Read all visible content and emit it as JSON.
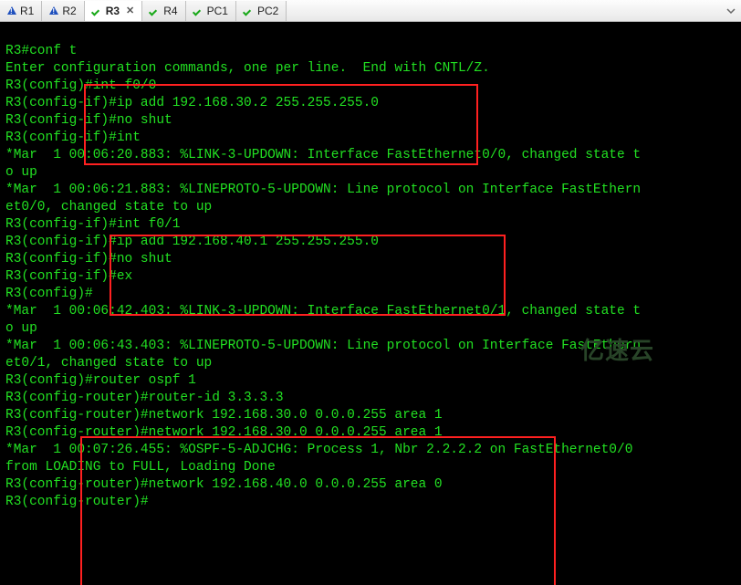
{
  "tabs": [
    {
      "label": "R1",
      "icon": "warn",
      "active": false
    },
    {
      "label": "R2",
      "icon": "warn",
      "active": false
    },
    {
      "label": "R3",
      "icon": "check",
      "active": true,
      "closable": true
    },
    {
      "label": "R4",
      "icon": "check",
      "active": false
    },
    {
      "label": "PC1",
      "icon": "check",
      "active": false
    },
    {
      "label": "PC2",
      "icon": "check",
      "active": false
    }
  ],
  "watermark": "亿速云",
  "terminal_lines": [
    "R3#conf t",
    "Enter configuration commands, one per line.  End with CNTL/Z.",
    "R3(config)#int f0/0",
    "R3(config-if)#ip add 192.168.30.2 255.255.255.0",
    "R3(config-if)#no shut",
    "R3(config-if)#int",
    "*Mar  1 00:06:20.883: %LINK-3-UPDOWN: Interface FastEthernet0/0, changed state t",
    "o up",
    "*Mar  1 00:06:21.883: %LINEPROTO-5-UPDOWN: Line protocol on Interface FastEthern",
    "et0/0, changed state to up",
    "R3(config-if)#int f0/1",
    "R3(config-if)#ip add 192.168.40.1 255.255.255.0",
    "R3(config-if)#no shut",
    "R3(config-if)#ex",
    "R3(config)#",
    "*Mar  1 00:06:42.403: %LINK-3-UPDOWN: Interface FastEthernet0/1, changed state t",
    "o up",
    "*Mar  1 00:06:43.403: %LINEPROTO-5-UPDOWN: Line protocol on Interface FastEthern",
    "et0/1, changed state to up",
    "R3(config)#router ospf 1",
    "R3(config-router)#router-id 3.3.3.3",
    "R3(config-router)#network 192.168.30.0 0.0.0.255 area 1",
    "R3(config-router)#network 192.168.30.0 0.0.0.255 area 1",
    "*Mar  1 00:07:26.455: %OSPF-5-ADJCHG: Process 1, Nbr 2.2.2.2 on FastEthernet0/0 ",
    "from LOADING to FULL, Loading Done",
    "R3(config-router)#network 192.168.40.0 0.0.0.255 area 0",
    "R3(config-router)#"
  ]
}
